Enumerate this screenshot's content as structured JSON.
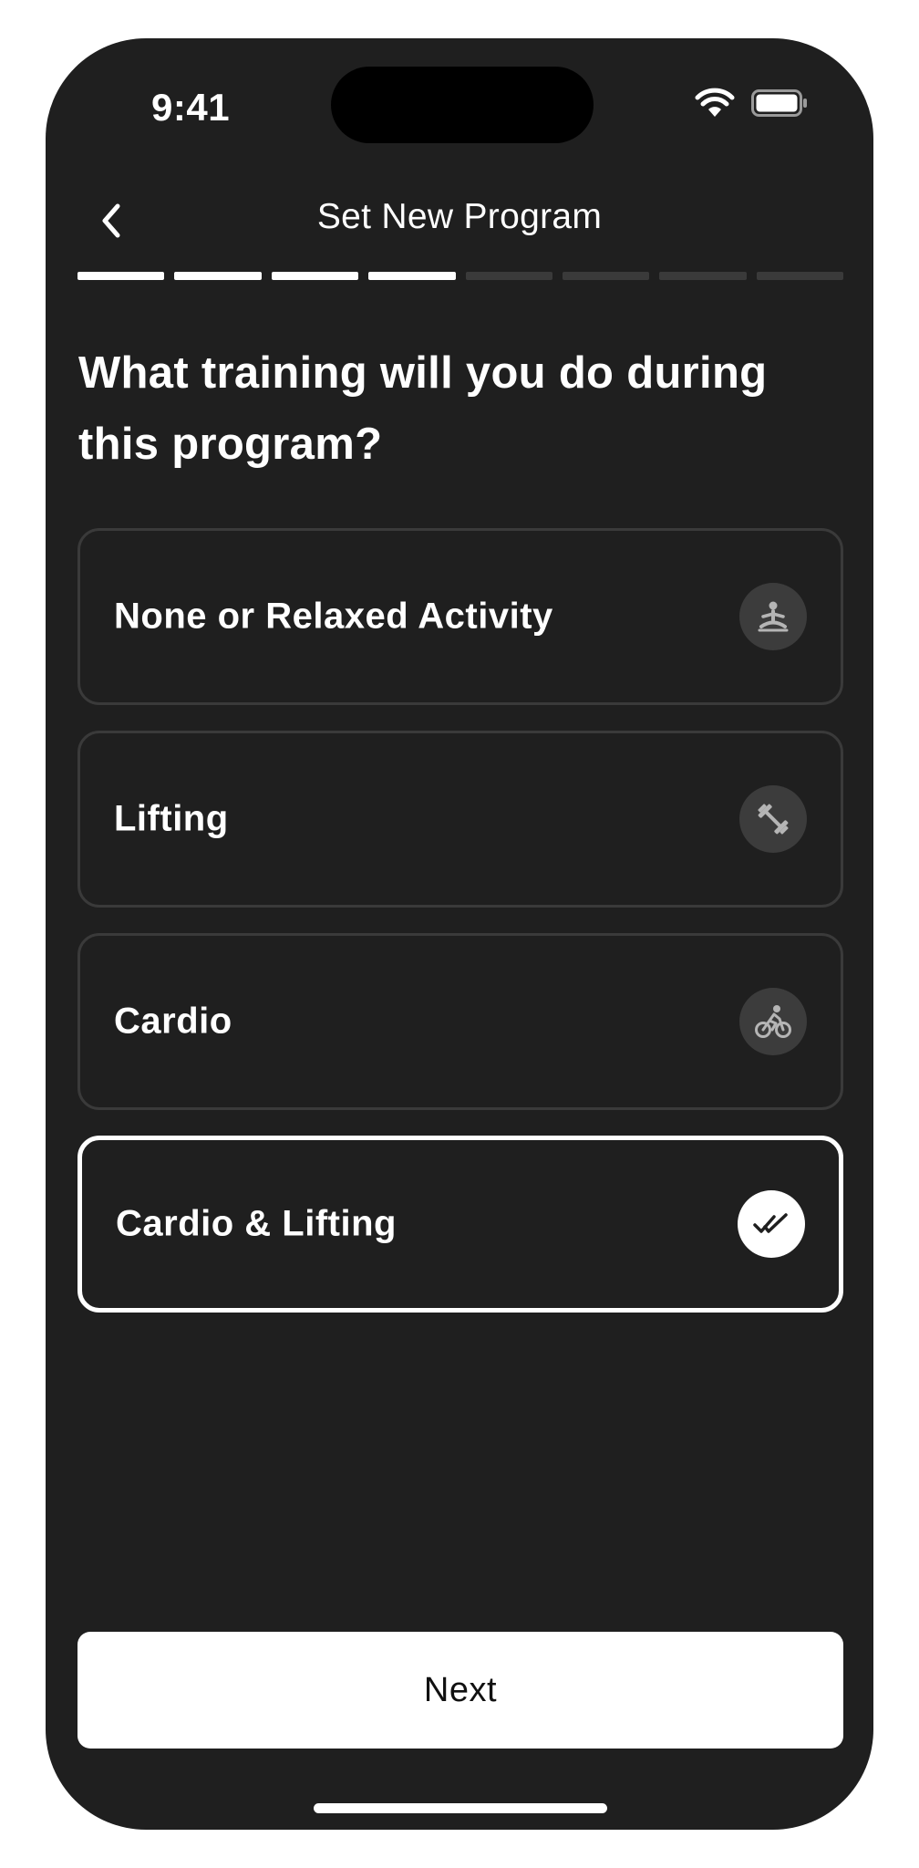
{
  "status_bar": {
    "time": "9:41",
    "icons": [
      "wifi-icon",
      "battery-icon"
    ]
  },
  "header": {
    "back_icon": "chevron-left-icon",
    "title": "Set New Program"
  },
  "progress": {
    "total_steps": 8,
    "completed_steps": 4
  },
  "question": "What training will you do during this program?",
  "options": [
    {
      "label": "None or Relaxed Activity",
      "icon": "meditation-icon",
      "selected": false
    },
    {
      "label": "Lifting",
      "icon": "dumbbell-icon",
      "selected": false
    },
    {
      "label": "Cardio",
      "icon": "cycling-icon",
      "selected": false
    },
    {
      "label": "Cardio & Lifting",
      "icon": "double-check-icon",
      "selected": true
    }
  ],
  "next_button": {
    "label": "Next"
  },
  "colors": {
    "background": "#1f1f1f",
    "text": "#ffffff",
    "border": "#3a3a3a",
    "icon_bg": "#3c3c3c",
    "accent": "#ffffff"
  }
}
